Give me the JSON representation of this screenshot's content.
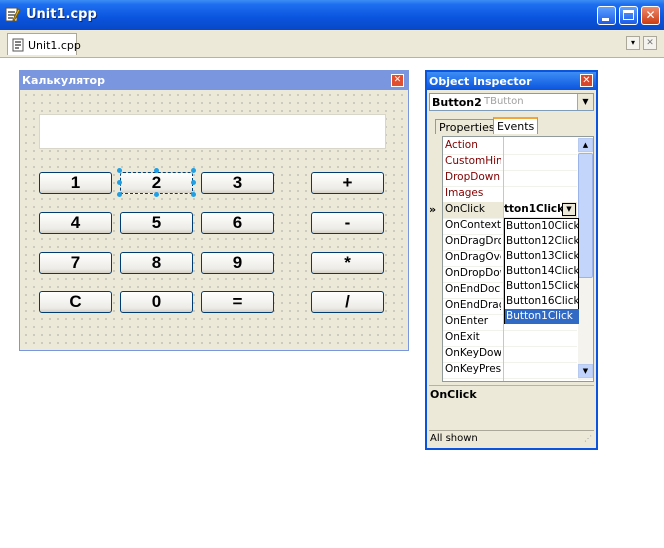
{
  "window": {
    "title": "Unit1.cpp",
    "tab": "Unit1.cpp"
  },
  "form": {
    "title": "Калькулятор",
    "display_value": "",
    "buttons": [
      {
        "label": "1"
      },
      {
        "label": "2"
      },
      {
        "label": "3"
      },
      {
        "label": "+"
      },
      {
        "label": "4"
      },
      {
        "label": "5"
      },
      {
        "label": "6"
      },
      {
        "label": "-"
      },
      {
        "label": "7"
      },
      {
        "label": "8"
      },
      {
        "label": "9"
      },
      {
        "label": "*"
      },
      {
        "label": "C"
      },
      {
        "label": "0"
      },
      {
        "label": "="
      },
      {
        "label": "/"
      }
    ]
  },
  "inspector": {
    "title": "Object Inspector",
    "object_name": "Button2",
    "object_class": "TButton",
    "tabs": [
      "Properties",
      "Events"
    ],
    "active_tab": "Events",
    "events": [
      {
        "name": "Action",
        "value": ""
      },
      {
        "name": "CustomHint",
        "value": ""
      },
      {
        "name": "DropDownM",
        "value": ""
      },
      {
        "name": "Images",
        "value": ""
      },
      {
        "name": "OnClick",
        "value": "tton1Click"
      },
      {
        "name": "OnContextP",
        "value": ""
      },
      {
        "name": "OnDragDrop",
        "value": ""
      },
      {
        "name": "OnDragOve",
        "value": ""
      },
      {
        "name": "OnDropDow",
        "value": ""
      },
      {
        "name": "OnEndDock",
        "value": ""
      },
      {
        "name": "OnEndDrag",
        "value": ""
      },
      {
        "name": "OnEnter",
        "value": ""
      },
      {
        "name": "OnExit",
        "value": ""
      },
      {
        "name": "OnKeyDown",
        "value": ""
      },
      {
        "name": "OnKeyPress",
        "value": ""
      }
    ],
    "dropdown_options": [
      "Button10Click",
      "Button12Click",
      "Button13Click",
      "Button14Click",
      "Button15Click",
      "Button16Click",
      "Button1Click"
    ],
    "dropdown_selected": "Button1Click",
    "description_title": "OnClick",
    "status": "All shown"
  },
  "colors": {
    "accent": "#0a54dd",
    "selection": "#316ac5",
    "property_ref": "#800000"
  }
}
